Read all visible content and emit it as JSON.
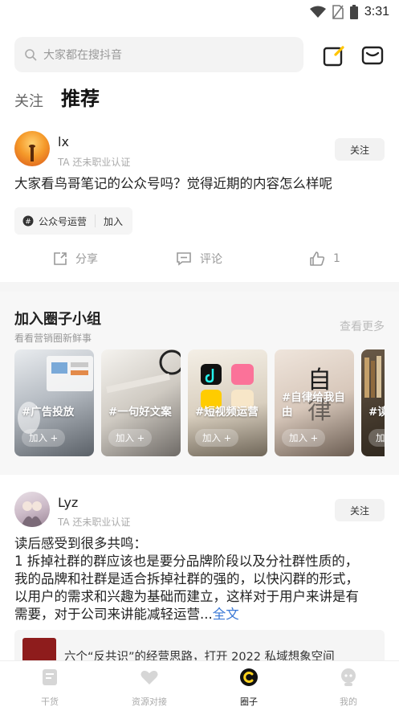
{
  "status_bar": {
    "time": "3:31"
  },
  "search": {
    "placeholder": "大家都在搜抖音"
  },
  "header_icons": {
    "edit": "edit-square-icon",
    "mail": "mail-icon"
  },
  "feed_tabs": [
    {
      "label": "关注",
      "active": false
    },
    {
      "label": "推荐",
      "active": true
    }
  ],
  "post1": {
    "username": "lx",
    "certification": "TA 还未职业认证",
    "follow_label": "关注",
    "text": "大家看鸟哥笔记的公众号吗？觉得近期的内容怎么样呢",
    "group_tag": {
      "name": "公众号运营",
      "join_label": "加入"
    },
    "actions": {
      "share": "分享",
      "comment": "评论",
      "like_count": "1"
    }
  },
  "groups_section": {
    "title": "加入圈子小组",
    "subtitle": "看看营销圈新鲜事",
    "more_label": "查看更多",
    "cards": [
      {
        "name": "#广告投放",
        "join_label": "加入 +"
      },
      {
        "name": "#一句好文案",
        "join_label": "加入 +"
      },
      {
        "name": "#短视频运营",
        "join_label": "加入 +"
      },
      {
        "name": "#自律给我自由",
        "join_label": "加入 +"
      },
      {
        "name": "#读",
        "join_label": "加"
      }
    ]
  },
  "post2": {
    "username": "Lyz",
    "certification": "TA 还未职业认证",
    "follow_label": "关注",
    "text_lines": [
      "读后感受到很多共鸣：",
      "1 拆掉社群的群应该也是要分品牌阶段以及分社群性质的，",
      "我的品牌和社群是适合拆掉社群的强的，以快闪群的形式，",
      "以用户的需求和兴趣为基础而建立，这样对于用户来讲是有",
      "需要，对于公司来讲能减轻运营..."
    ],
    "more_label": "全文",
    "link_title": "六个“反共识”的经营思路，打开 2022 私域想象空间"
  },
  "bottom_nav": [
    {
      "label": "干货",
      "icon": "document-icon",
      "active": false
    },
    {
      "label": "资源对接",
      "icon": "heart-icon",
      "active": false
    },
    {
      "label": "圈子",
      "icon": "circle-icon",
      "active": true
    },
    {
      "label": "我的",
      "icon": "profile-icon",
      "active": false
    }
  ],
  "colors": {
    "accent": "#ffd21e",
    "link": "#3a78d6"
  }
}
